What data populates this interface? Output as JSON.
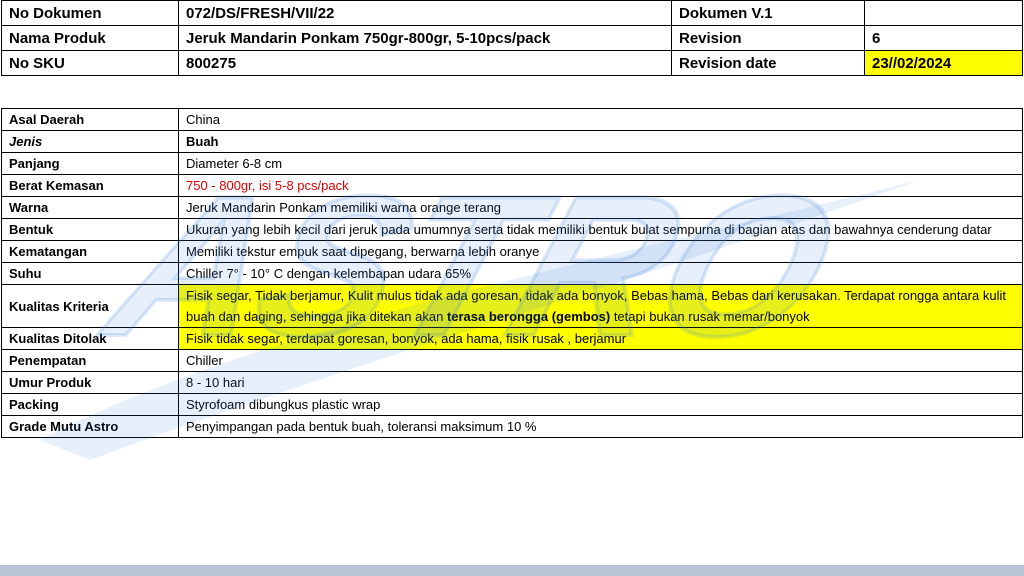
{
  "header": {
    "r1": {
      "l1": "No Dokumen",
      "v1": "072/DS/FRESH/VII/22",
      "l2": "Dokumen V.1",
      "v2": ""
    },
    "r2": {
      "l1": "Nama Produk",
      "v1": "Jeruk Mandarin Ponkam 750gr-800gr, 5-10pcs/pack",
      "l2": "Revision",
      "v2": "6"
    },
    "r3": {
      "l1": "No SKU",
      "v1": "800275",
      "l2": "Revision date",
      "v2": "23//02/2024"
    }
  },
  "spec": {
    "asal": {
      "label": "Asal Daerah",
      "value": "China"
    },
    "jenis": {
      "label": "Jenis",
      "value": "Buah"
    },
    "panjang": {
      "label": "Panjang",
      "value": "Diameter 6-8 cm"
    },
    "berat": {
      "label": "Berat Kemasan",
      "value": "750 -  800gr, isi 5-8 pcs/pack"
    },
    "warna": {
      "label": "Warna",
      "value": "Jeruk Mandarin Ponkam memiliki warna orange terang"
    },
    "bentuk": {
      "label": "Bentuk",
      "value": "Ukuran yang lebih kecil dari jeruk pada umumnya serta tidak memiliki bentuk bulat sempurna di bagian atas dan bawahnya cenderung datar"
    },
    "kematangan": {
      "label": "Kematangan",
      "value": "Memiliki tekstur empuk saat dipegang, berwarna lebih oranye"
    },
    "suhu": {
      "label": "Suhu",
      "value": "Chiller 7° - 10° C dengan kelembapan udara 65%"
    },
    "kualitas_kriteria": {
      "label": "Kualitas Kriteria",
      "value_a": "Fisik segar, Tidak berjamur, Kulit mulus tidak ada goresan, tidak ada bonyok, Bebas hama, Bebas dari kerusakan. Terdapat rongga antara kulit buah dan daging, sehingga jika ditekan akan ",
      "value_b": "terasa berongga (gembos)",
      "value_c": " tetapi bukan rusak memar/bonyok"
    },
    "kualitas_ditolak": {
      "label": "Kualitas Ditolak",
      "value": "Fisik tidak segar, terdapat goresan, bonyok, ada hama, fisik rusak , berjamur"
    },
    "penempatan": {
      "label": "Penempatan",
      "value": "Chiller"
    },
    "umur": {
      "label": "Umur Produk",
      "value": "8 - 10 hari"
    },
    "packing": {
      "label": "Packing",
      "value": "Styrofoam dibungkus plastic wrap"
    },
    "grade": {
      "label": "Grade Mutu Astro",
      "value": "Penyimpangan pada bentuk buah, toleransi maksimum 10 %"
    }
  },
  "watermark": {
    "text": "ASTRO",
    "color": "#3a7bd5"
  }
}
